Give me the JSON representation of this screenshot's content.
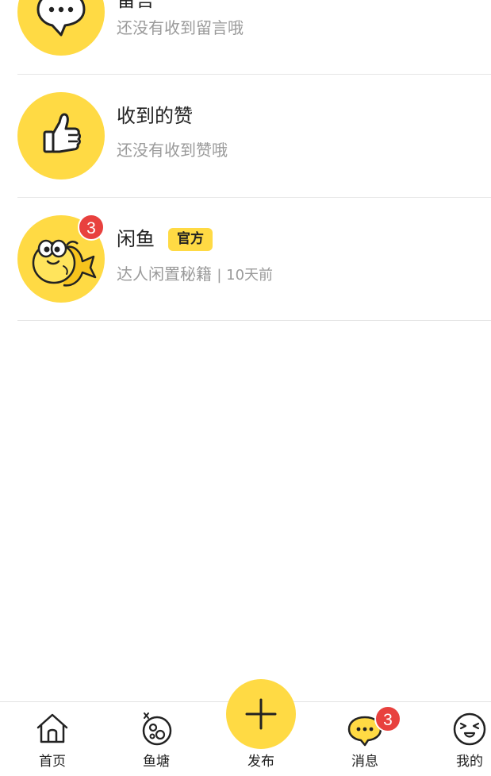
{
  "messages": [
    {
      "title": "留言",
      "subtitle": "还没有收到留言哦",
      "icon": "speech-bubble-icon"
    },
    {
      "title": "收到的赞",
      "subtitle": "还没有收到赞哦",
      "icon": "thumbs-up-icon"
    },
    {
      "title": "闲鱼",
      "tag": "官方",
      "subtitle": "达人闲置秘籍",
      "time": "| 10天前",
      "badge": "3",
      "icon": "fish-mascot-icon"
    }
  ],
  "tabbar": {
    "tabs": [
      {
        "label": "首页",
        "icon": "home-icon"
      },
      {
        "label": "鱼塘",
        "icon": "fish-pond-icon"
      },
      {
        "label": "发布",
        "icon": "plus-icon"
      },
      {
        "label": "消息",
        "icon": "message-icon",
        "badge": "3"
      },
      {
        "label": "我的",
        "icon": "profile-face-icon"
      }
    ]
  },
  "colors": {
    "accent": "#ffda44",
    "badge": "#e8413e",
    "secondary_text": "#9a9a9a"
  }
}
